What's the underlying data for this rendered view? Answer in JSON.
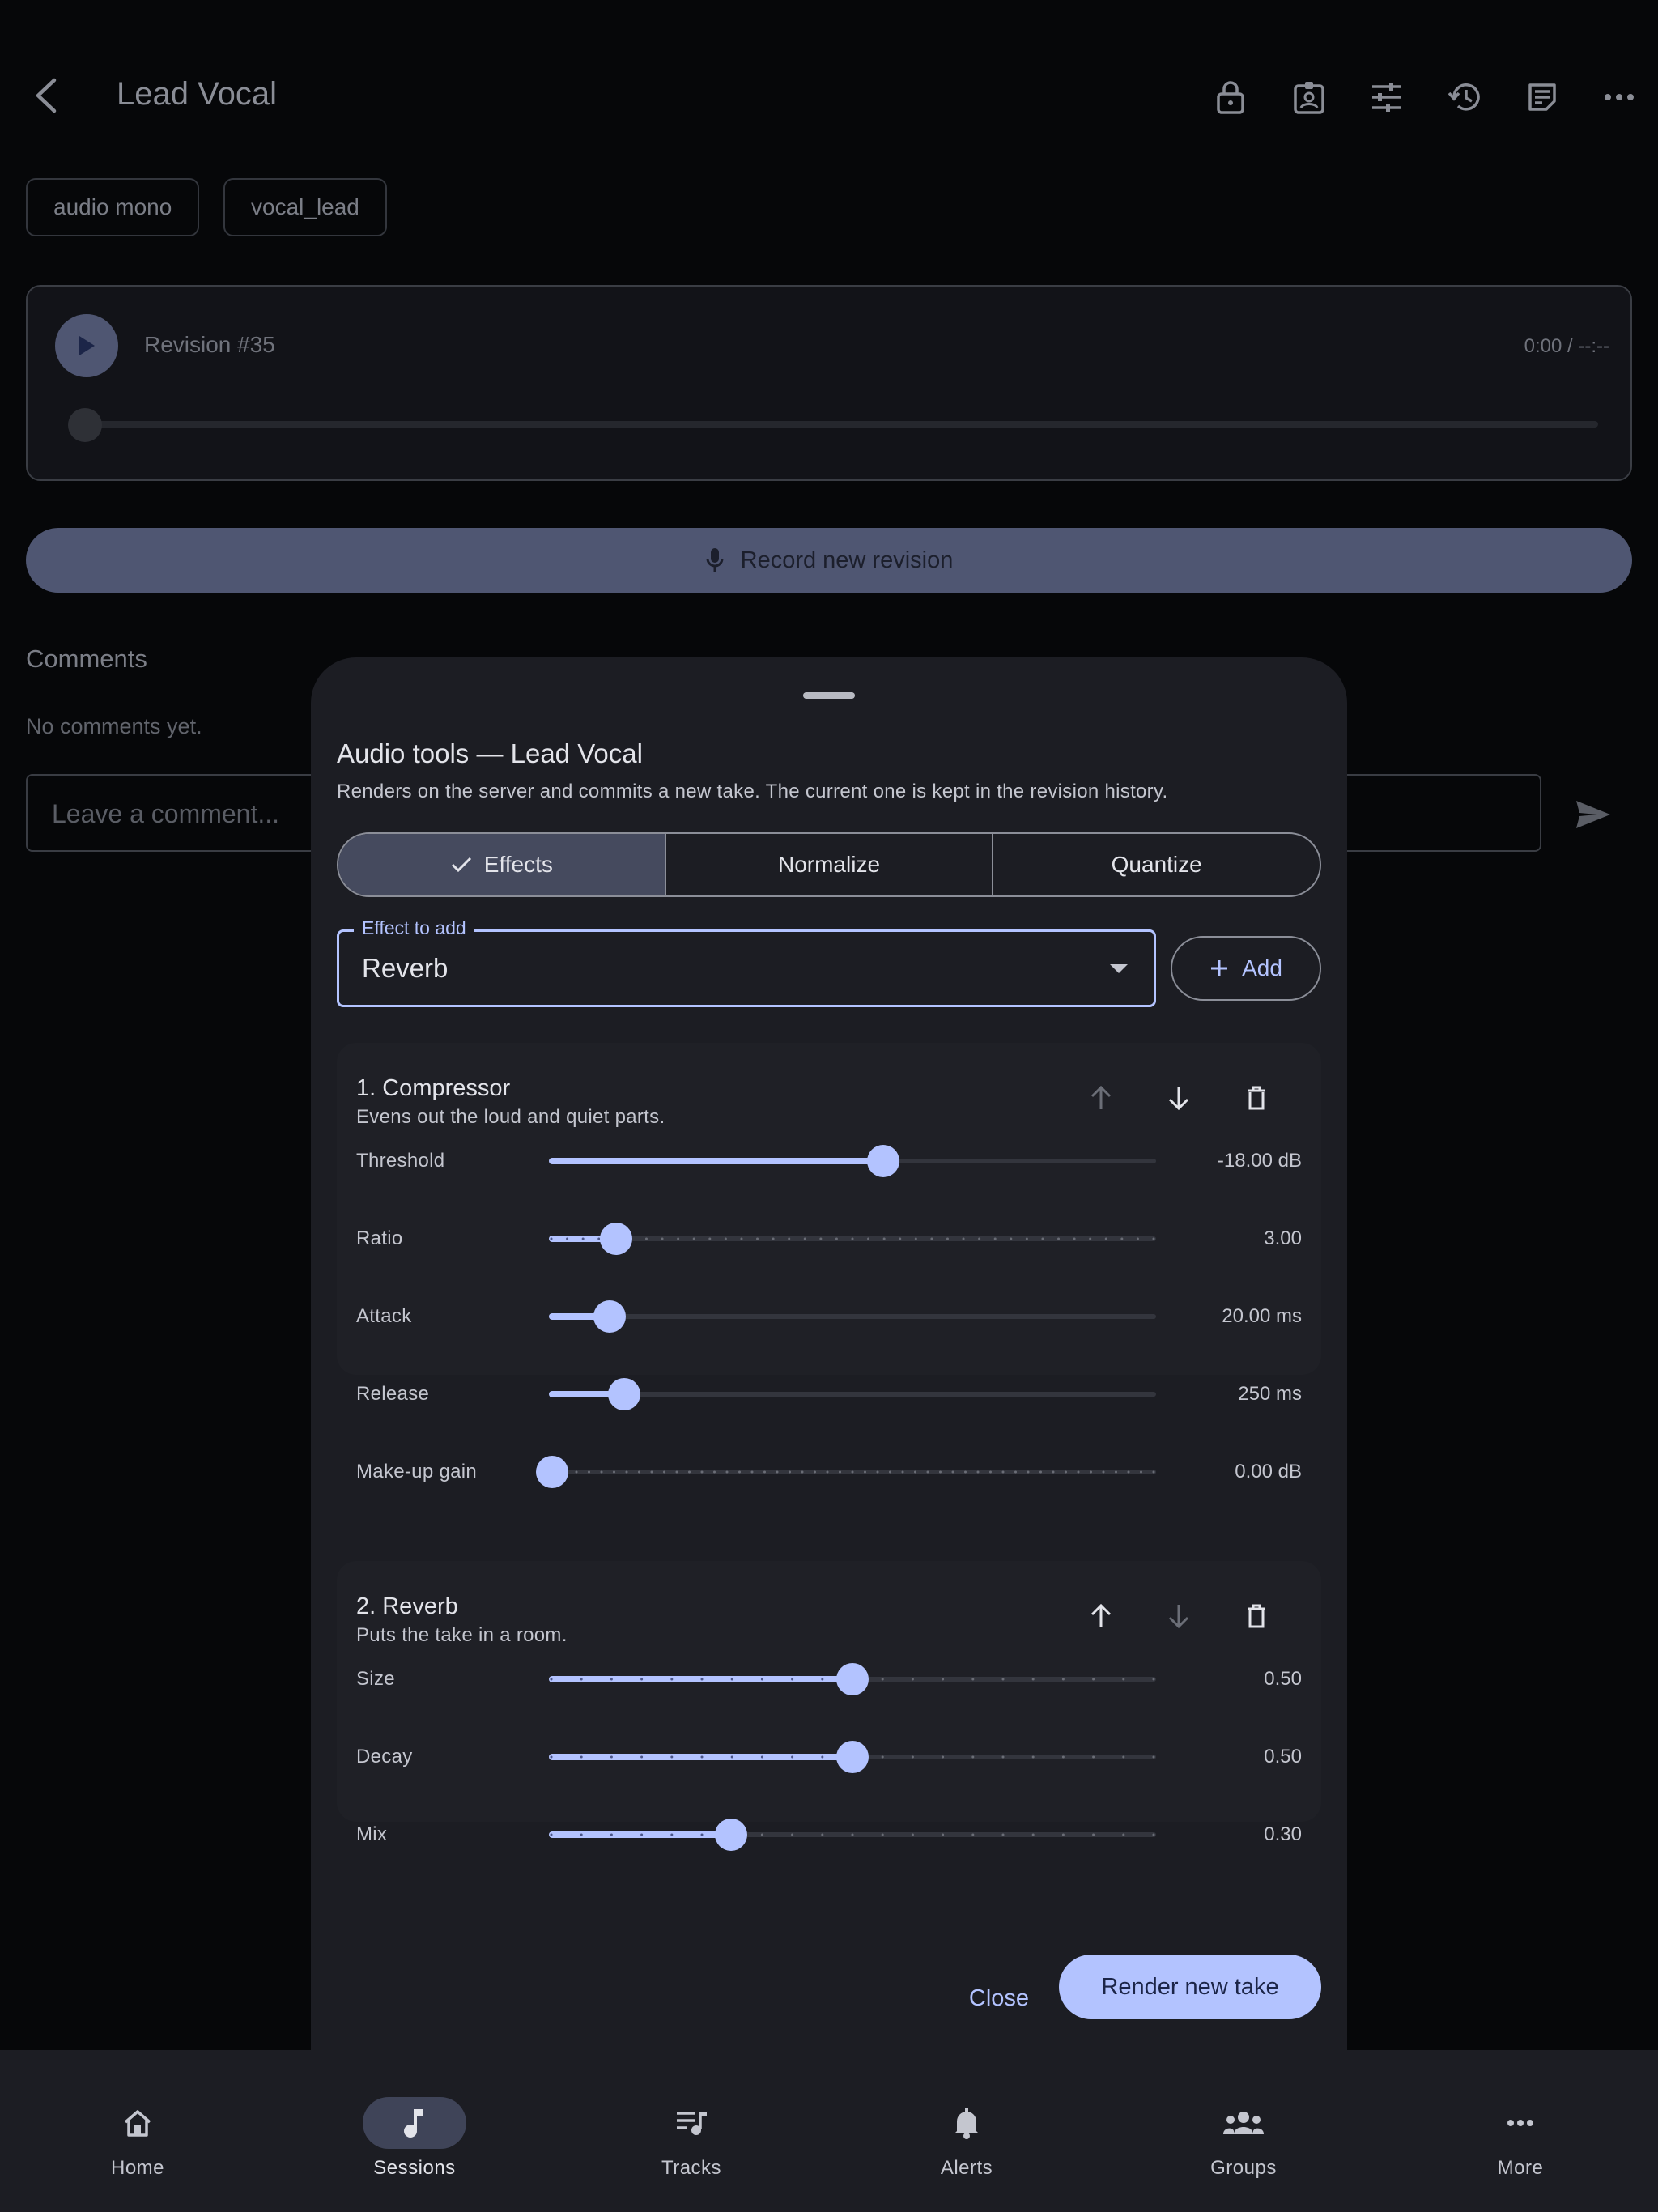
{
  "appbar": {
    "title": "Lead Vocal",
    "actions": [
      "lock-icon",
      "badge-icon",
      "tune-icon",
      "history-icon",
      "notes-icon",
      "more-horiz-icon"
    ]
  },
  "tags": [
    "audio mono",
    "vocal_lead"
  ],
  "player": {
    "revision": "Revision #35",
    "time": "0:00 / --:--",
    "progress": 0
  },
  "record_button": "Record new revision",
  "comments": {
    "title": "Comments",
    "empty": "No comments yet.",
    "placeholder": "Leave a comment..."
  },
  "sheet": {
    "title": "Audio tools — Lead Vocal",
    "subtitle": "Renders on the server and commits a new take. The current one is kept in the revision history.",
    "tabs": [
      {
        "label": "Effects",
        "selected": true
      },
      {
        "label": "Normalize",
        "selected": false
      },
      {
        "label": "Quantize",
        "selected": false
      }
    ],
    "effect_select": {
      "label": "Effect to add",
      "value": "Reverb"
    },
    "add_label": "Add",
    "effects": [
      {
        "title": "1. Compressor",
        "description": "Evens out the loud and quiet parts.",
        "move_up_enabled": false,
        "move_down_enabled": true,
        "params": [
          {
            "label": "Threshold",
            "value": "-18.00 dB",
            "fraction": 0.55,
            "stepped": false
          },
          {
            "label": "Ratio",
            "value": "3.00",
            "fraction": 0.11,
            "stepped": true,
            "ticks": 39
          },
          {
            "label": "Attack",
            "value": "20.00 ms",
            "fraction": 0.1,
            "stepped": false
          },
          {
            "label": "Release",
            "value": "250 ms",
            "fraction": 0.124,
            "stepped": false
          },
          {
            "label": "Make-up gain",
            "value": "0.00 dB",
            "fraction": 0.0,
            "stepped": true,
            "ticks": 49
          }
        ]
      },
      {
        "title": "2. Reverb",
        "description": "Puts the take in a room.",
        "move_up_enabled": true,
        "move_down_enabled": false,
        "params": [
          {
            "label": "Size",
            "value": "0.50",
            "fraction": 0.5,
            "stepped": true,
            "ticks": 21
          },
          {
            "label": "Decay",
            "value": "0.50",
            "fraction": 0.5,
            "stepped": true,
            "ticks": 21
          },
          {
            "label": "Mix",
            "value": "0.30",
            "fraction": 0.3,
            "stepped": true,
            "ticks": 21
          }
        ]
      }
    ],
    "close_label": "Close",
    "render_label": "Render new take"
  },
  "nav": {
    "items": [
      {
        "label": "Home",
        "icon": "home-icon",
        "active": false
      },
      {
        "label": "Sessions",
        "icon": "music-note-icon",
        "active": true
      },
      {
        "label": "Tracks",
        "icon": "queue-music-icon",
        "active": false
      },
      {
        "label": "Alerts",
        "icon": "bell-icon",
        "active": false
      },
      {
        "label": "Groups",
        "icon": "groups-icon",
        "active": false
      },
      {
        "label": "More",
        "icon": "more-horiz-icon",
        "active": false
      }
    ]
  },
  "colors": {
    "accent": "#b3c3ff",
    "surface": "#1c1d23",
    "background": "#060709"
  }
}
